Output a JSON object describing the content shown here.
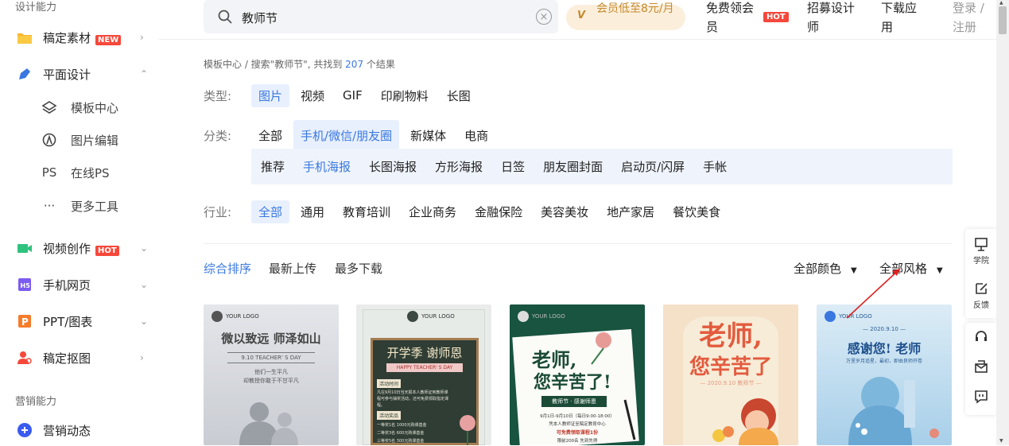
{
  "sidebar": {
    "section1": "设计能力",
    "section2": "营销能力",
    "items": [
      {
        "label": "稿定素材",
        "badge": "NEW",
        "chev": "›"
      },
      {
        "label": "平面设计",
        "chev": "⌃"
      },
      {
        "label": "视频创作",
        "badge": "HOT",
        "chev": "⌄"
      },
      {
        "label": "手机网页",
        "chev": "⌄"
      },
      {
        "label": "PPT/图表",
        "chev": "⌄"
      },
      {
        "label": "稿定抠图",
        "chev": "›"
      },
      {
        "label": "营销动态"
      }
    ],
    "sub_items": [
      {
        "label": "模板中心"
      },
      {
        "label": "图片编辑"
      },
      {
        "label": "在线PS",
        "icon_text": "PS"
      },
      {
        "label": "更多工具",
        "icon_text": "···"
      }
    ]
  },
  "topbar": {
    "search_value": "教师节",
    "vip_text": "会员低至8元/月",
    "vip_icon_text": "V",
    "links": [
      "免费领会员",
      "招募设计师",
      "下载应用"
    ],
    "hot_badge": "HOT",
    "login": "登录 / 注册"
  },
  "breadcrumb": {
    "prefix": "模板中心 / 搜索\"教师节\", 共找到",
    "count": "207",
    "suffix": "个结果"
  },
  "filters": {
    "type": {
      "label": "类型:",
      "options": [
        "图片",
        "视频",
        "GIF",
        "印刷物料",
        "长图"
      ],
      "active": 0
    },
    "category": {
      "label": "分类:",
      "options": [
        "全部",
        "手机/微信/朋友圈",
        "新媒体",
        "电商"
      ],
      "active": 1
    },
    "subcategory": {
      "options": [
        "推荐",
        "手机海报",
        "长图海报",
        "方形海报",
        "日签",
        "朋友圈封面",
        "启动页/闪屏",
        "手帐"
      ],
      "active": 1
    },
    "industry": {
      "label": "行业:",
      "options": [
        "全部",
        "通用",
        "教育培训",
        "企业商务",
        "金融保险",
        "美容美妆",
        "地产家居",
        "餐饮美食"
      ],
      "active": 0
    }
  },
  "sort": {
    "options": [
      "综合排序",
      "最新上传",
      "最多下载"
    ],
    "active": 0,
    "color_filter": "全部颜色",
    "style_filter": "全部风格",
    "caret": "▼"
  },
  "cards": [
    {
      "logo": "YOUR LOGO",
      "title": "微以致远 师泽如山",
      "sub": "9.10 TEACHER' S DAY",
      "line1": "他们一生平凡",
      "line2": "却教授你敢于不甘平凡"
    },
    {
      "logo": "YOUR LOGO",
      "title": "开学季 谢师恩",
      "sub": "HAPPY TEACHER' S DAY",
      "tag1": "活动时间",
      "body1": "凡在9月10日当天报本人教师证到教师课程可参与抽奖活动，还可免费领取指定课程。",
      "tag2": "活动奖品",
      "prize1": "一等奖1名  1000元购课基金",
      "prize2": "二等奖3名  600元购课基金",
      "prize3": "三等奖5名  300元购课基金"
    },
    {
      "logo": "YOUR LOGO",
      "title1": "老师,",
      "title2": "您辛苦了!",
      "band": "教师节 · 感谢师恩",
      "line1": "9月1日-9月10日（每日9:00-18:00）",
      "line2": "凭本人教师证至稿定教育中心",
      "line3": "可免费领取课程1份",
      "line4": "限前200名 先到先得"
    },
    {
      "title1": "老师,",
      "title2": "您辛苦了",
      "date": "— 2020.9.10 教师节 —"
    },
    {
      "logo": "YOUR LOGO",
      "date": "— 2020.9.10 —",
      "title": "感谢您! 老师",
      "sub": "万里岁月追星，最初，即由良师开卷"
    }
  ],
  "right_tools": [
    {
      "label": "学院"
    },
    {
      "label": "反馈"
    }
  ],
  "colors": {
    "accent": "#3a78e0",
    "badge": "#f5483b",
    "vip": "#c68a2e"
  }
}
